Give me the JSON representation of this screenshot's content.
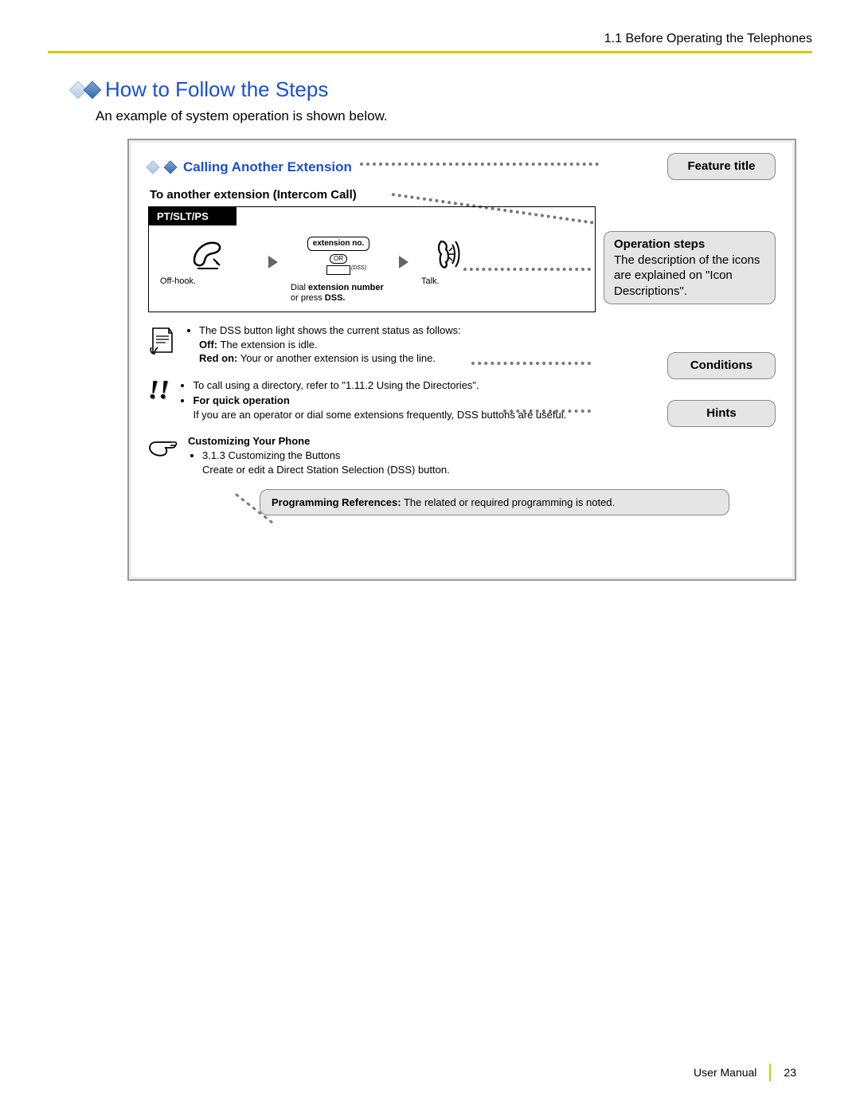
{
  "header": {
    "breadcrumb": "1.1 Before Operating the Telephones"
  },
  "section": {
    "title": "How to Follow the Steps",
    "intro": "An example of system operation is shown below."
  },
  "example": {
    "feature_title": "Calling Another Extension",
    "label_feature_title": "Feature title",
    "subtitle": "To another extension (Intercom Call)",
    "op_tab": "PT/SLT/PS",
    "step1": {
      "caption": "Off-hook."
    },
    "step2": {
      "box": "extension no.",
      "or": "OR",
      "dss": "(DSS)",
      "caption_pre": "Dial ",
      "caption_bold": "extension number",
      "caption_post": "\nor press ",
      "caption_bold2": "DSS."
    },
    "step3": {
      "caption": "Talk."
    },
    "op_steps_title": "Operation steps",
    "op_steps_text": "The description of the icons are explained on \"Icon Descriptions\".",
    "conditions_label": "Conditions",
    "conditions": {
      "line1": "The DSS button light shows the current status as follows:",
      "off_b": "Off:",
      "off_t": " The extension is idle.",
      "red_b": "Red on:",
      "red_t": " Your or another extension is using the line."
    },
    "hints_label": "Hints",
    "hints": {
      "line1": "To call using a directory, refer to \"1.11.2 Using the Directories\".",
      "quick_b": "For quick operation",
      "quick_t": "If you are an operator or dial some extensions frequently, DSS buttons are useful."
    },
    "custom": {
      "title": "Customizing Your Phone",
      "item": "3.1.3 Customizing the Buttons",
      "desc": "Create or edit a Direct Station Selection (DSS) button."
    },
    "prog_ref_b": "Programming References:",
    "prog_ref_t": " The related or required programming is noted."
  },
  "footer": {
    "manual": "User Manual",
    "page": "23"
  }
}
